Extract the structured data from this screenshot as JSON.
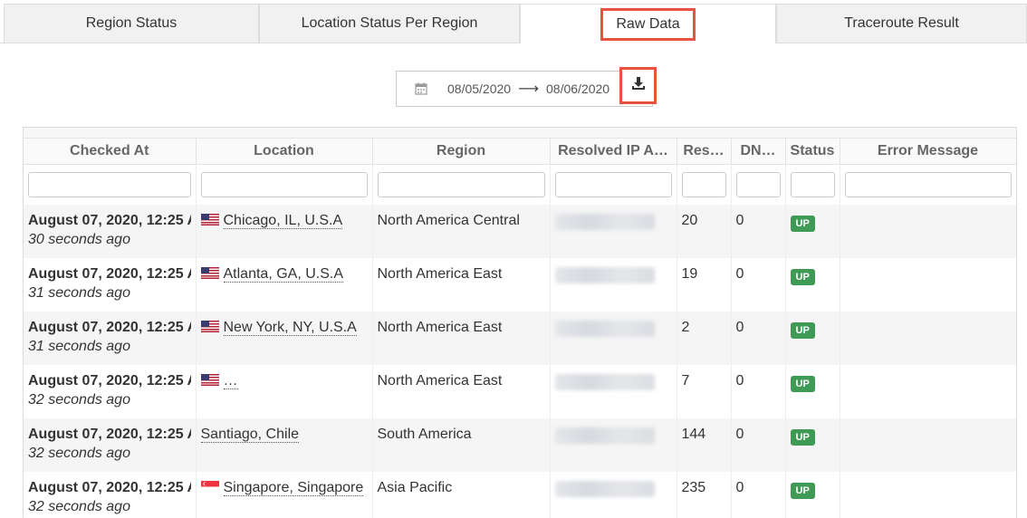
{
  "tabs": [
    {
      "label": "Region Status"
    },
    {
      "label": "Location Status Per Region"
    },
    {
      "label": "Raw Data"
    },
    {
      "label": "Traceroute Result"
    }
  ],
  "date_range": {
    "start": "08/05/2020",
    "end": "08/06/2020",
    "arrow": "⟶"
  },
  "table": {
    "headers": [
      "Checked At",
      "Location",
      "Region",
      "Resolved IP A…",
      "Res…",
      "DN…",
      "Status",
      "Error Message"
    ],
    "rows": [
      {
        "time": "August 07, 2020, 12:25 A",
        "ago": "30 seconds ago",
        "location": "Chicago, IL, U.S.A",
        "flag": "us",
        "region": "North America Central",
        "res": "20",
        "dns": "0",
        "status": "UP",
        "error": ""
      },
      {
        "time": "August 07, 2020, 12:25 A",
        "ago": "31 seconds ago",
        "location": "Atlanta, GA, U.S.A",
        "flag": "us",
        "region": "North America East",
        "res": "19",
        "dns": "0",
        "status": "UP",
        "error": ""
      },
      {
        "time": "August 07, 2020, 12:25 A",
        "ago": "31 seconds ago",
        "location": "New York, NY, U.S.A",
        "flag": "us",
        "region": "North America East",
        "res": "2",
        "dns": "0",
        "status": "UP",
        "error": ""
      },
      {
        "time": "August 07, 2020, 12:25 A",
        "ago": "32 seconds ago",
        "location": "…",
        "flag": "us",
        "region": "North America East",
        "res": "7",
        "dns": "0",
        "status": "UP",
        "error": ""
      },
      {
        "time": "August 07, 2020, 12:25 A",
        "ago": "32 seconds ago",
        "location": "Santiago, Chile",
        "flag": "",
        "region": "South America",
        "res": "144",
        "dns": "0",
        "status": "UP",
        "error": ""
      },
      {
        "time": "August 07, 2020, 12:25 A",
        "ago": "32 seconds ago",
        "location": "Singapore, Singapore",
        "flag": "sg",
        "region": "Asia Pacific",
        "res": "235",
        "dns": "0",
        "status": "UP",
        "error": ""
      }
    ]
  },
  "colors": {
    "highlight": "#e8533f",
    "status_up": "#3f9a56"
  },
  "icons": {
    "date": "calendar-icon",
    "download": "download-icon"
  }
}
